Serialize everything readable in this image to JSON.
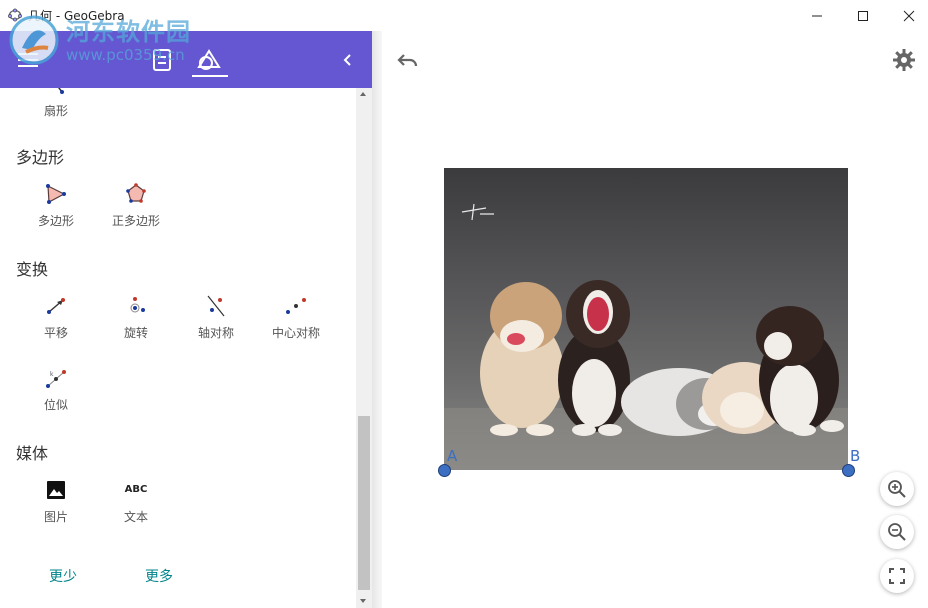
{
  "window": {
    "title": "几何 - GeoGebra",
    "controls": [
      "minimize-icon",
      "maximize-icon",
      "close-icon"
    ]
  },
  "watermark": {
    "text": "河东软件园",
    "url": "www.pc0359.cn"
  },
  "header": {
    "icons": [
      "menu-icon",
      "algebra-view-icon",
      "tools-icon",
      "collapse-panel-icon"
    ],
    "accent": "#6557d2"
  },
  "tools_panel": {
    "top_tool": {
      "label": "扇形",
      "icon": "sector-icon"
    },
    "sections": [
      {
        "title": "多边形",
        "tools": [
          {
            "label": "多边形",
            "icon": "polygon-icon"
          },
          {
            "label": "正多边形",
            "icon": "regular-polygon-icon"
          }
        ]
      },
      {
        "title": "变换",
        "tools": [
          {
            "label": "平移",
            "icon": "translate-icon"
          },
          {
            "label": "旋转",
            "icon": "rotate-icon"
          },
          {
            "label": "轴对称",
            "icon": "reflect-line-icon"
          },
          {
            "label": "中心对称",
            "icon": "reflect-point-icon"
          },
          {
            "label": "位似",
            "icon": "dilate-icon"
          }
        ]
      },
      {
        "title": "媒体",
        "tools": [
          {
            "label": "图片",
            "icon": "image-icon"
          },
          {
            "label": "文本",
            "icon": "text-icon",
            "glyph": "ABC"
          }
        ]
      }
    ],
    "less_label": "更少",
    "more_label": "更多",
    "link_color": "#00838a"
  },
  "graphics": {
    "points": [
      {
        "name": "A"
      },
      {
        "name": "B"
      }
    ],
    "point_color": "#3c6fc1",
    "image_content": "photo-of-puppies",
    "buttons": [
      "undo-icon",
      "settings-icon",
      "zoom-in-icon",
      "zoom-out-icon",
      "fullscreen-icon"
    ]
  }
}
